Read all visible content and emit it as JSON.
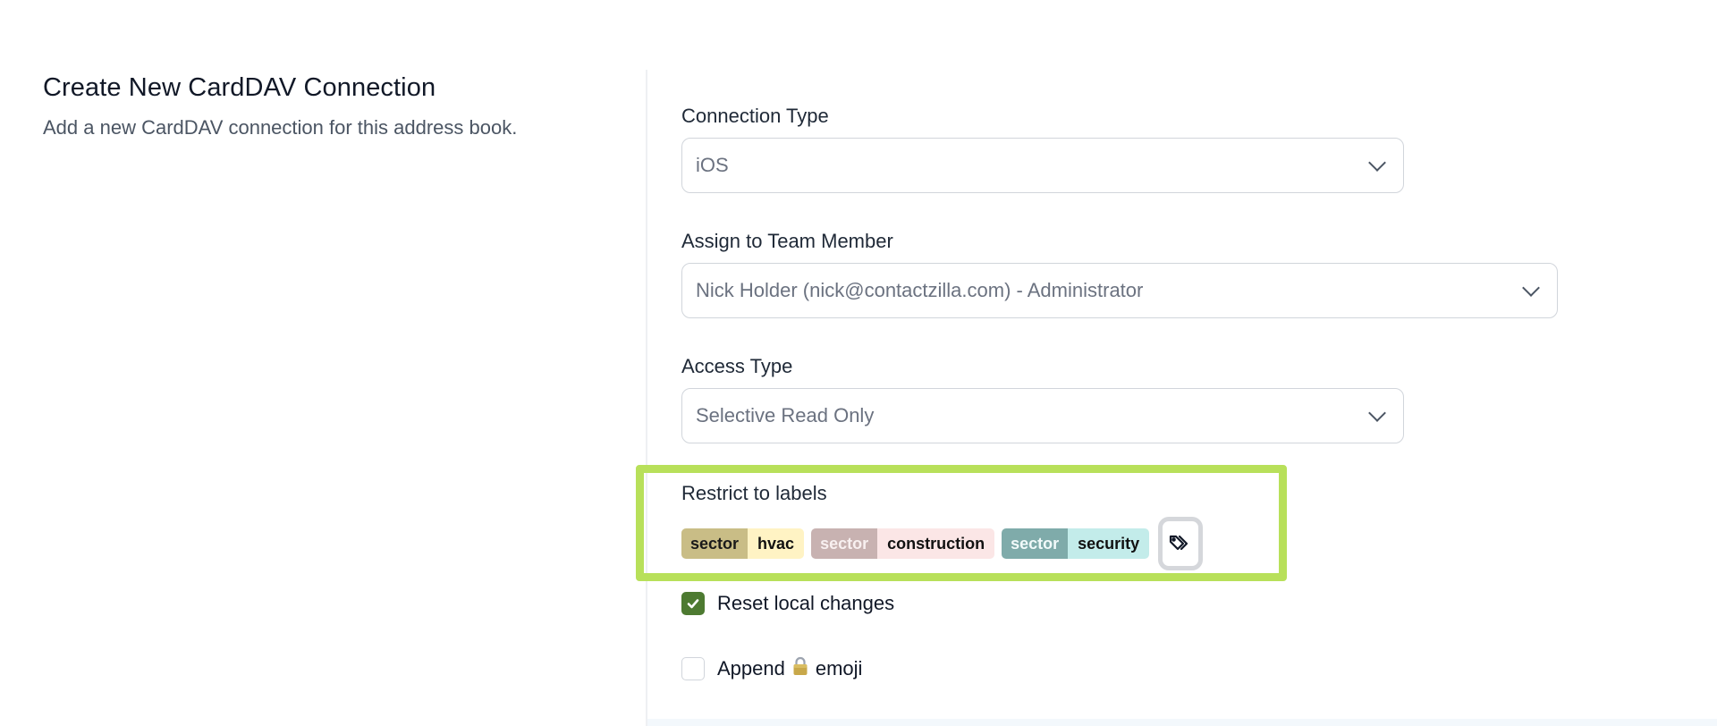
{
  "section": {
    "title": "Create New CardDAV Connection",
    "subtitle": "Add a new CardDAV connection for this address book."
  },
  "form": {
    "connection_type": {
      "label": "Connection Type",
      "value": "iOS"
    },
    "team_member": {
      "label": "Assign to Team Member",
      "value": "Nick Holder (nick@contactzilla.com) - Administrator"
    },
    "access_type": {
      "label": "Access Type",
      "value": "Selective Read Only"
    },
    "restrict_labels": {
      "label": "Restrict to labels",
      "tags": [
        {
          "key": "sector",
          "value": "hvac"
        },
        {
          "key": "sector",
          "value": "construction"
        },
        {
          "key": "sector",
          "value": "security"
        }
      ],
      "add_button_icon": "tag-icon"
    },
    "reset_local_changes": {
      "label": "Reset local changes",
      "checked": true
    },
    "append_emoji": {
      "label_before": "Append",
      "emoji_icon": "lock-icon",
      "label_after": "emoji",
      "checked": false
    }
  },
  "colors": {
    "highlight": "#b8e05a",
    "checkbox_checked": "#4d7a31"
  }
}
